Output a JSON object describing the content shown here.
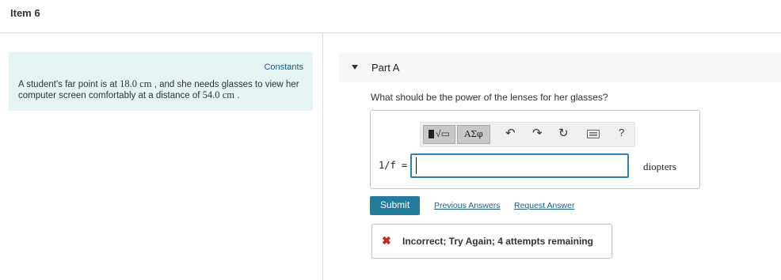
{
  "item": {
    "title": "Item 6"
  },
  "left": {
    "constants_label": "Constants",
    "problem": {
      "p1": "A student's far point is at ",
      "d1_val": "18.0",
      "d1_unit": "cm",
      "p2": " , and she needs glasses to view her computer screen comfortably at a distance of ",
      "d2_val": "54.0",
      "d2_unit": "cm",
      "p3": " ."
    }
  },
  "part": {
    "label": "Part A",
    "question": "What should be the power of the lenses for her glasses?"
  },
  "toolbar": {
    "templates_icon": "templates-icon",
    "greek_label": "ΑΣφ",
    "undo_icon": "undo-icon",
    "redo_icon": "redo-icon",
    "reset_icon": "reset-icon",
    "keyboard_icon": "keyboard-icon",
    "help_label": "?"
  },
  "answer": {
    "variable_label": "1/f =",
    "value": "",
    "unit": "diopters"
  },
  "actions": {
    "submit_label": "Submit",
    "previous_answers": "Previous Answers",
    "request_answer": "Request Answer"
  },
  "feedback": {
    "icon": "x-icon",
    "text": "Incorrect; Try Again; 4 attempts remaining"
  },
  "colors": {
    "accent": "#237d9a",
    "link": "#1a5f8a",
    "error": "#c4241b",
    "panel_bg": "#e7f4f4",
    "input_border": "#2c82b8"
  }
}
